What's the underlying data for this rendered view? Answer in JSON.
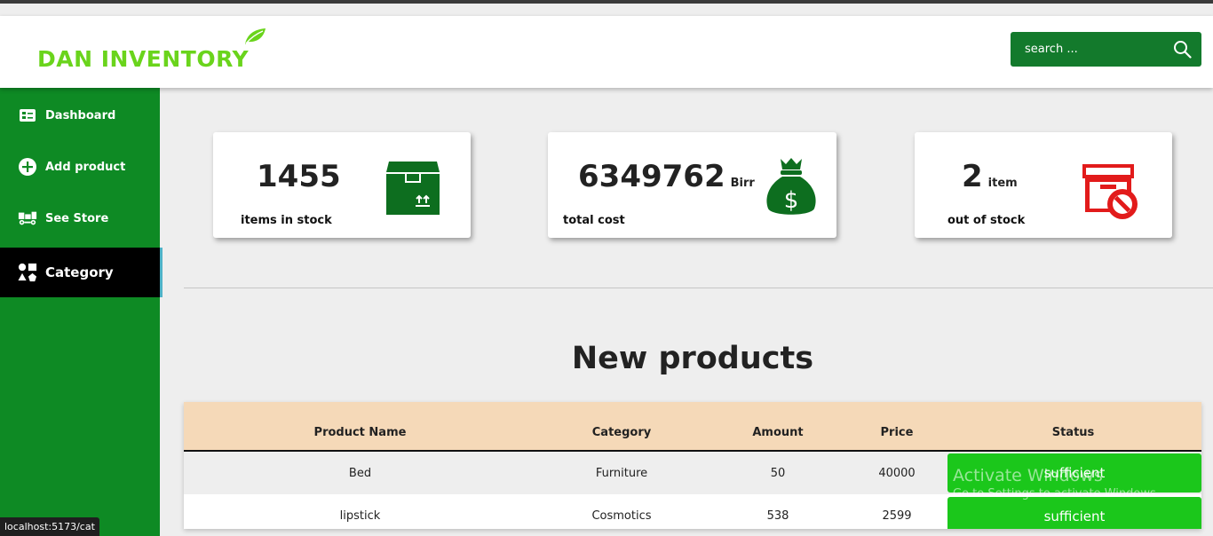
{
  "app": {
    "logo_text": "DAN INVENTORY",
    "brand_color": "#6ad41c"
  },
  "search": {
    "placeholder": "search ...",
    "icon": "search-icon"
  },
  "sidebar": {
    "items": [
      {
        "label": "Dashboard",
        "icon": "dashboard-icon"
      },
      {
        "label": "Add product",
        "icon": "plus-circle-icon"
      },
      {
        "label": "See Store",
        "icon": "store-cart-icon"
      },
      {
        "label": "Category",
        "icon": "category-shapes-icon",
        "active": true
      }
    ]
  },
  "cards": [
    {
      "value": "1455",
      "unit": "",
      "label": "items in stock",
      "icon": "box-icon"
    },
    {
      "value": "6349762",
      "unit": "Birr",
      "label": "total cost",
      "icon": "money-bag-icon"
    },
    {
      "value": "2",
      "unit": "item",
      "label": "out of stock",
      "icon": "archive-blocked-icon"
    }
  ],
  "section": {
    "title": "New products"
  },
  "table": {
    "headers": [
      "Product Name",
      "Category",
      "Amount",
      "Price",
      "Status"
    ],
    "rows": [
      {
        "name": "Bed",
        "category": "Furniture",
        "amount": "50",
        "price": "40000",
        "status": "sufficient"
      },
      {
        "name": "lipstick",
        "category": "Cosmotics",
        "amount": "538",
        "price": "2599",
        "status": "sufficient"
      }
    ]
  },
  "statusbar": {
    "url": "localhost:5173/cat"
  },
  "os_watermark": {
    "line1": "Activate Windows",
    "line2": "Go to Settings to activate Windows."
  },
  "colors": {
    "sidebar_bg": "#0e8a24",
    "search_bg": "#137a2c",
    "status_ok": "#1bc71b",
    "table_header_bg": "#f5d9b8",
    "alert_red": "#e21b1b"
  }
}
